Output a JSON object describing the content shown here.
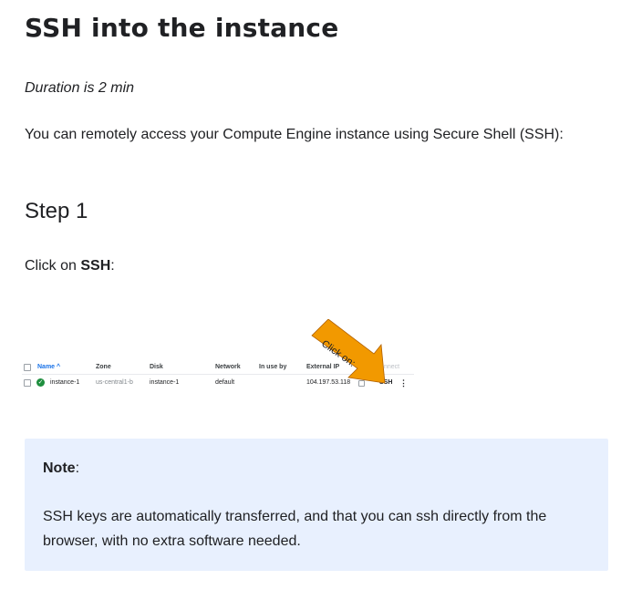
{
  "page": {
    "title": "SSH into the instance",
    "duration": "Duration is 2 min",
    "intro": "You can remotely access your Compute Engine instance using Secure Shell (SSH):"
  },
  "step": {
    "heading": "Step 1",
    "click_prefix": "Click on ",
    "click_target": "SSH",
    "click_suffix": ":"
  },
  "screenshot": {
    "headers": {
      "name": "Name ^",
      "zone": "Zone",
      "disk": "Disk",
      "network": "Network",
      "in_use_by": "In use by",
      "external_ip": "External IP",
      "connect": "Connect"
    },
    "row": {
      "status_icon": "check-circle-icon",
      "name": "instance-1",
      "zone": "us-central1-b",
      "disk": "instance-1",
      "network": "default",
      "external_ip": "104.197.53.118",
      "connect": "SSH",
      "menu_icon": "more-vert-icon"
    },
    "callout": {
      "text": "Click on:",
      "color": "#f29900"
    }
  },
  "note": {
    "label": "Note",
    "label_suffix": ":",
    "body": "SSH keys are automatically transferred, and that you can ssh directly from the browser, with no extra software needed.",
    "background": "#e8f0fe"
  }
}
